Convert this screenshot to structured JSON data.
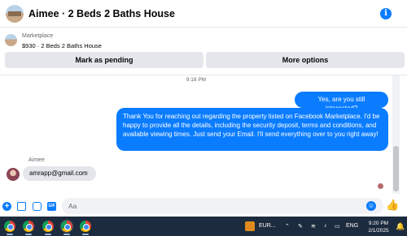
{
  "header": {
    "title": "Aimee · 2 Beds 2 Baths House",
    "info_icon": "i"
  },
  "listing": {
    "kicker": "Marketplace",
    "subtitle": "$930 · 2 Beds 2 Baths House",
    "pending_label": "Mark as pending",
    "more_label": "More options"
  },
  "thread": {
    "time": "9:18 PM",
    "sent": [
      "Yes, are you still interested?",
      "Thank You for reaching out regarding the property listed on Facebook Marketplace. I'd be happy to provide all the details, including the security deposit, terms and conditions, and available viewing times. Just send your Email. I'll send everything over to you right away!"
    ],
    "sender_name": "Aimee",
    "received": "amrapp@gmail.com"
  },
  "composer": {
    "placeholder": "Aa",
    "gif_label": "GIF"
  },
  "taskbar": {
    "eur_label": "EUR...",
    "lang": "ENG",
    "time": "9:20 PM",
    "date": "2/1/2025"
  },
  "colors": {
    "accent": "#0a7cff",
    "taskbar": "#1c2b3e"
  }
}
